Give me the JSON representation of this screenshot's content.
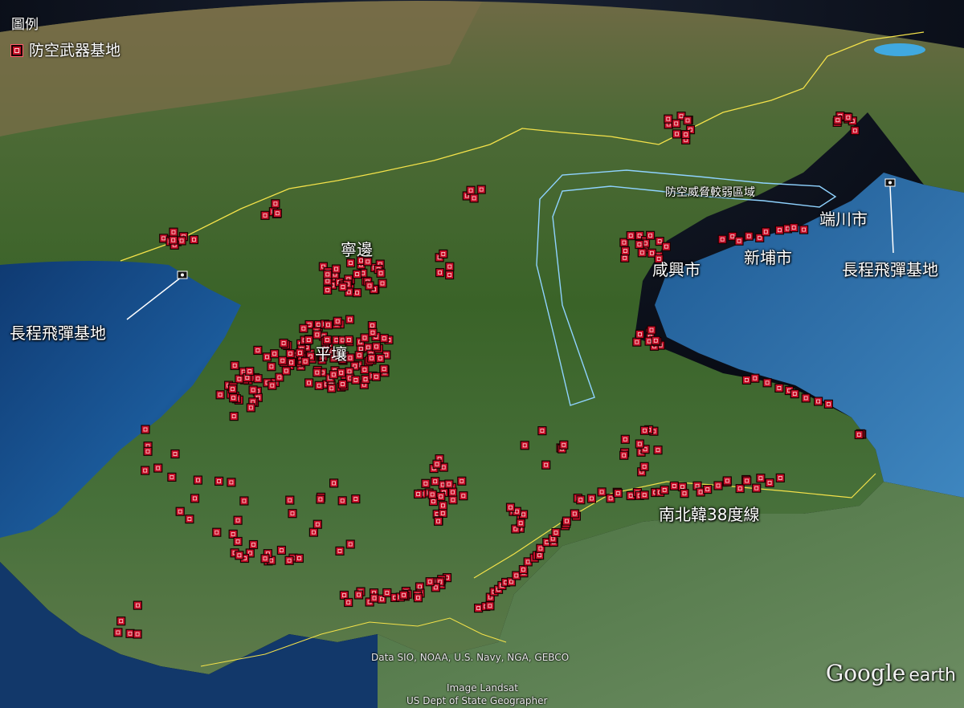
{
  "legend": {
    "title": "圖例",
    "items": [
      {
        "label": "防空武器基地",
        "symbol_color": "#c9102a"
      }
    ]
  },
  "labels": {
    "pyongyang": "平壤",
    "nyongbyon": "寧邊",
    "hamhung": "咸興市",
    "sinpo": "新埔市",
    "tanchon": "端川市",
    "missile_base_west": "長程飛彈基地",
    "missile_base_east": "長程飛彈基地",
    "weak_zone": "防空威脅較弱區域",
    "dmz": "南北韓38度線"
  },
  "credits": {
    "data": "Data SIO, NOAA, U.S. Navy, NGA, GEBCO",
    "image": "Image Landsat",
    "geographer": "US Dept of State Geographer",
    "logo_google": "Google",
    "logo_earth": "earth"
  },
  "colors": {
    "marker": "#c9102a",
    "border": "#f4e24a",
    "weak_zone_outline": "#8fd3ff",
    "sea": "#1d4f86",
    "land": "#3e6b2a"
  },
  "icons": {
    "missile_base": "missile-base-icon",
    "marker": "air-defense-site-icon"
  }
}
